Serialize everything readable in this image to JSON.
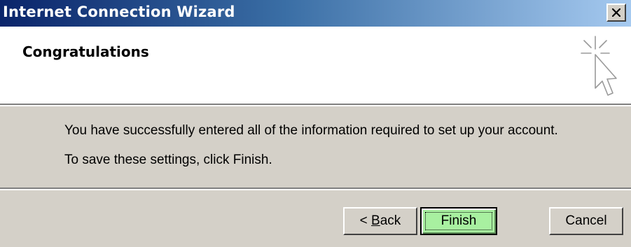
{
  "window": {
    "title": "Internet Connection Wizard",
    "close_glyph": "×"
  },
  "header": {
    "title": "Congratulations",
    "icon": "wizard-cursor-icon"
  },
  "body": {
    "message_1": "You have successfully entered all of the information required to set up your account.",
    "message_2": "To save these settings, click Finish."
  },
  "buttons": {
    "back": {
      "prefix": "< ",
      "accel": "B",
      "rest": "ack"
    },
    "finish": "Finish",
    "cancel": "Cancel"
  },
  "colors": {
    "titlebar_start": "#0a246a",
    "titlebar_end": "#a6caf0",
    "dialog_face": "#d4d0c8",
    "finish_highlight": "#a8f0a0"
  }
}
